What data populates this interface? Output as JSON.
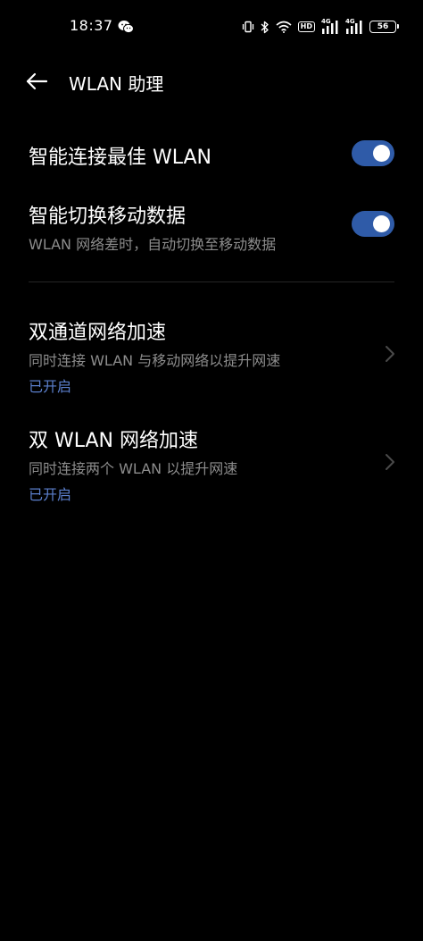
{
  "status_bar": {
    "time": "18:37",
    "network_4g_1": "4G",
    "network_4g_2": "4G",
    "hd": "HD",
    "battery": "56"
  },
  "header": {
    "title": "WLAN 助理"
  },
  "settings": {
    "smart_connect": {
      "title": "智能连接最佳 WLAN",
      "enabled": true
    },
    "smart_switch": {
      "title": "智能切换移动数据",
      "subtitle": "WLAN 网络差时，自动切换至移动数据",
      "enabled": true
    },
    "dual_channel": {
      "title": "双通道网络加速",
      "subtitle": "同时连接 WLAN 与移动网络以提升网速",
      "status": "已开启"
    },
    "dual_wlan": {
      "title": "双 WLAN 网络加速",
      "subtitle": "同时连接两个 WLAN 以提升网速",
      "status": "已开启"
    }
  },
  "colors": {
    "background": "#000000",
    "toggle_on": "#2f5ba8",
    "status_accent": "#5b7fcc",
    "subtitle": "#8c8c8c"
  },
  "icons": {
    "back": "arrow-left-icon",
    "chat": "wechat-icon",
    "chevron": "chevron-right-icon"
  }
}
